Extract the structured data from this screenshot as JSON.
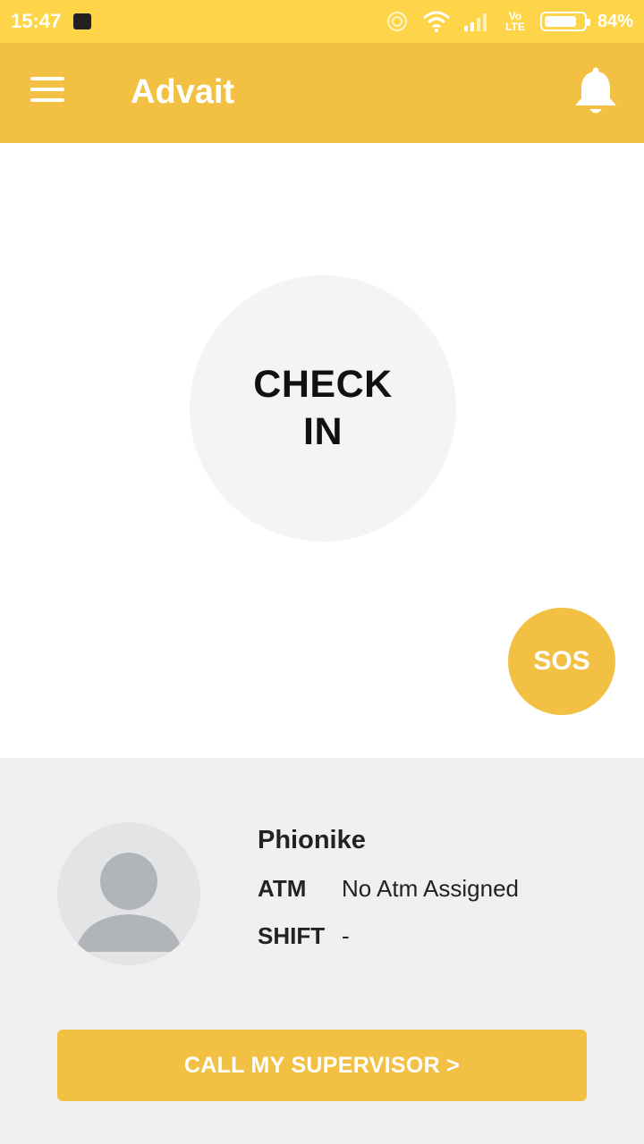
{
  "status_bar": {
    "time": "15:47",
    "network_label": "Vo LTE",
    "battery_percent_text": "84%",
    "battery_level": 0.84
  },
  "app_bar": {
    "title": "Advait",
    "menu_icon": "hamburger-icon",
    "notification_icon": "bell-icon"
  },
  "main": {
    "check_in_line1": "CHECK",
    "check_in_line2": "IN",
    "sos_label": "SOS"
  },
  "profile": {
    "name": "Phionike",
    "atm_label": "ATM",
    "atm_value": "No Atm Assigned",
    "shift_label": "SHIFT",
    "shift_value": "-",
    "avatar_icon": "person-icon"
  },
  "call_button": {
    "label": "CALL MY SUPERVISOR  >"
  },
  "colors": {
    "status_bar": "#FED549",
    "primary": "#F2C144",
    "panel_bg": "#F0F0F0",
    "circle_bg": "#F4F4F4"
  }
}
